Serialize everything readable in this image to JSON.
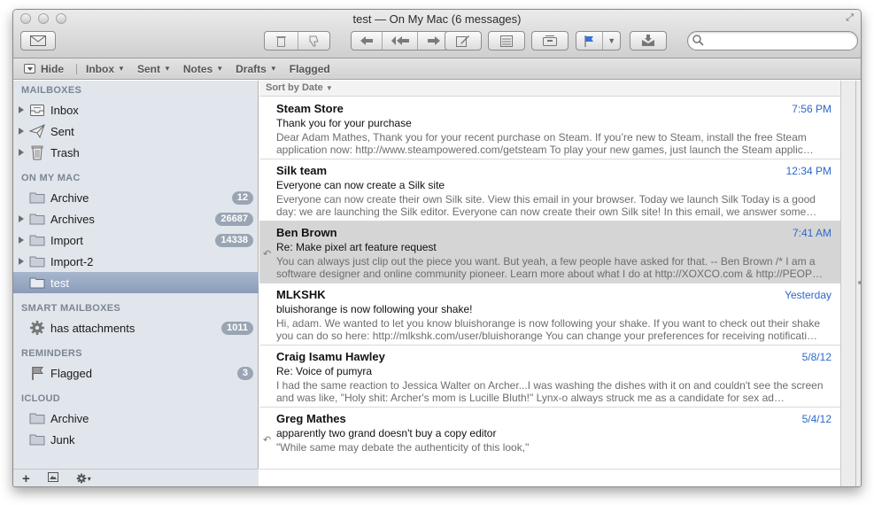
{
  "window": {
    "title": "test — On My Mac (6 messages)"
  },
  "toolbar": {
    "icons": [
      "compose-envelope-icon",
      "trash-icon",
      "junk-thumb-down-icon",
      "reply-icon",
      "reply-all-icon",
      "forward-icon",
      "new-note-icon",
      "notes-list-icon",
      "archive-icon",
      "flag-icon",
      "flag-dropdown-icon",
      "get-mail-icon"
    ],
    "search_placeholder": ""
  },
  "favorites": {
    "hide_label": "Hide",
    "items": [
      {
        "label": "Inbox",
        "has_menu": true
      },
      {
        "label": "Sent",
        "has_menu": true
      },
      {
        "label": "Notes",
        "has_menu": true
      },
      {
        "label": "Drafts",
        "has_menu": true
      },
      {
        "label": "Flagged",
        "has_menu": false
      }
    ]
  },
  "sidebar": {
    "mailboxes_header": "MAILBOXES",
    "mailboxes": [
      {
        "label": "Inbox",
        "icon": "inbox-tray-icon"
      },
      {
        "label": "Sent",
        "icon": "paper-plane-icon"
      },
      {
        "label": "Trash",
        "icon": "trash-can-icon"
      }
    ],
    "onmymac_header": "ON MY MAC",
    "onmymac": [
      {
        "label": "Archive",
        "badge": "12"
      },
      {
        "label": "Archives",
        "badge": "26687"
      },
      {
        "label": "Import",
        "badge": "14338"
      },
      {
        "label": "Import-2",
        "badge": ""
      },
      {
        "label": "test",
        "badge": ""
      }
    ],
    "smart_header": "SMART MAILBOXES",
    "smart": [
      {
        "label": "has attachments",
        "badge": "1011"
      }
    ],
    "reminders_header": "REMINDERS",
    "reminders": [
      {
        "label": "Flagged",
        "badge": "3"
      }
    ],
    "icloud_header": "ICLOUD",
    "icloud": [
      {
        "label": "Archive"
      },
      {
        "label": "Junk"
      }
    ],
    "footer": {
      "add": "+",
      "gear_caret": "▾"
    }
  },
  "list": {
    "sort_label": "Sort by Date",
    "messages": [
      {
        "from": "Steam Store",
        "date": "7:56 PM",
        "subject": "Thank you for your purchase",
        "preview": "Dear Adam Mathes, Thank you for your recent purchase on Steam. If you’re new to Steam, install the free Steam application now: http://www.steampowered.com/getsteam To play your new games, just launch the Steam applic…",
        "replied": false,
        "selected": false
      },
      {
        "from": "Silk team",
        "date": "12:34 PM",
        "subject": "Everyone can now create a Silk site",
        "preview": "Everyone can now create their own Silk site. View this email in your browser. Today we launch Silk Today is a good day: we are launching the Silk editor. Everyone can now create their own Silk site! In this email, we answer some…",
        "replied": false,
        "selected": false
      },
      {
        "from": "Ben Brown",
        "date": "7:41 AM",
        "subject": "Re: Make pixel art feature request",
        "preview": "You can always just clip out the piece you want. But yeah, a few people have asked for that. -- Ben Brown /* I am a software designer and online community pioneer. Learn more about what I do at http://XOXCO.com & http://PEOP…",
        "replied": true,
        "selected": true
      },
      {
        "from": "MLKSHK",
        "date": "Yesterday",
        "subject": "bluishorange is now following your shake!",
        "preview": "Hi, adam. We wanted to let you know bluishorange is now following your shake. If you want to check out their shake you can do so here: http://mlkshk.com/user/bluishorange You can change your preferences for receiving notificati…",
        "replied": false,
        "selected": false
      },
      {
        "from": "Craig Isamu Hawley",
        "date": "5/8/12",
        "subject": "Re: Voice of pumyra",
        "preview": "I had the same reaction to Jessica Walter on Archer...I was washing the dishes with it on and couldn't see the screen and was like, \"Holy shit: Archer's mom is Lucille Bluth!\" Lynx-o always struck me as a candidate for sex ad…",
        "replied": false,
        "selected": false
      },
      {
        "from": "Greg Mathes",
        "date": "5/4/12",
        "subject": "apparently two grand doesn't buy a copy editor",
        "preview": "\"While same may debate the authenticity of this look,\"",
        "replied": true,
        "selected": false
      }
    ]
  }
}
